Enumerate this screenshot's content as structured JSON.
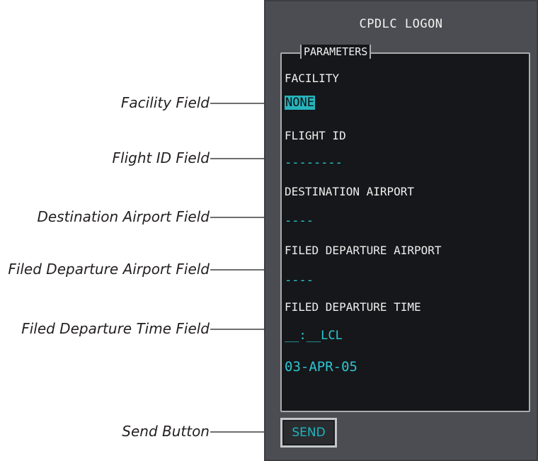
{
  "panel": {
    "title": "CPDLC LOGON",
    "group_label": "PARAMETERS",
    "fields": [
      {
        "label": "FACILITY",
        "value": "NONE",
        "selected": true
      },
      {
        "label": "FLIGHT ID",
        "value": "--------"
      },
      {
        "label": "DESTINATION AIRPORT",
        "value": "----"
      },
      {
        "label": "FILED DEPARTURE AIRPORT",
        "value": "----"
      },
      {
        "label": "FILED DEPARTURE TIME",
        "value": "__:__LCL"
      }
    ],
    "date": "03-APR-05",
    "send_label": "SEND"
  },
  "callouts": [
    "Facility Field",
    "Flight ID Field",
    "Destination Airport Field",
    "Filed Departure Airport Field",
    "Filed Departure Time Field",
    "Send Button"
  ],
  "colors": {
    "bezel": "#4b4d52",
    "screen": "#16171a",
    "cyan_value": "#29c9d2",
    "white_label": "#eeeeee",
    "leader_line": "#6d6e70"
  }
}
